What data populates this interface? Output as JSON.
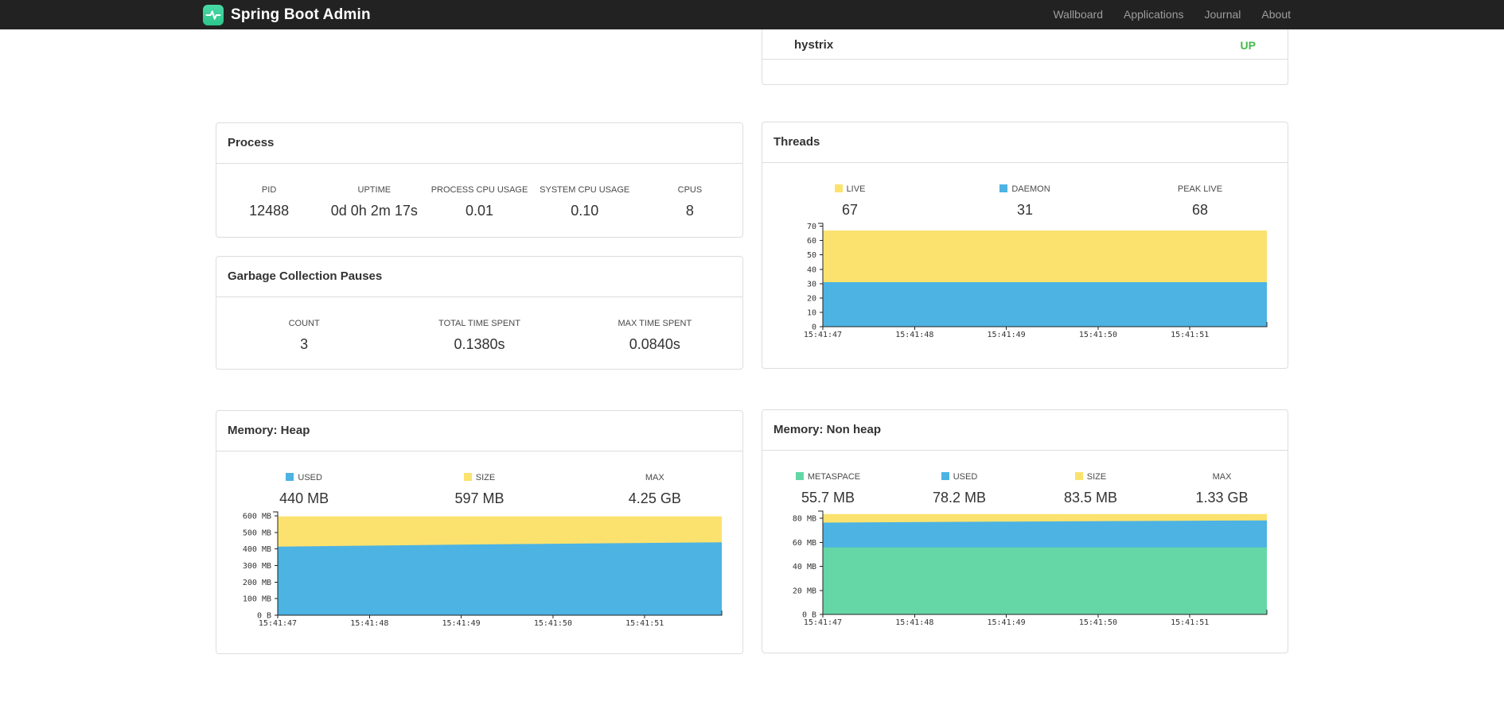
{
  "navbar": {
    "brand": "Spring Boot Admin",
    "links": [
      {
        "label": "Wallboard"
      },
      {
        "label": "Applications"
      },
      {
        "label": "Journal"
      },
      {
        "label": "About"
      }
    ]
  },
  "applications": {
    "rows": [
      {
        "name": "hystrix",
        "status": "UP",
        "status_color": "#45b94a"
      }
    ]
  },
  "process": {
    "title": "Process",
    "metrics": [
      {
        "label": "PID",
        "value": "12488"
      },
      {
        "label": "UPTIME",
        "value": "0d 0h 2m 17s"
      },
      {
        "label": "PROCESS CPU USAGE",
        "value": "0.01"
      },
      {
        "label": "SYSTEM CPU USAGE",
        "value": "0.10"
      },
      {
        "label": "CPUS",
        "value": "8"
      }
    ]
  },
  "gc": {
    "title": "Garbage Collection Pauses",
    "metrics": [
      {
        "label": "COUNT",
        "value": "3"
      },
      {
        "label": "TOTAL TIME SPENT",
        "value": "0.1380s"
      },
      {
        "label": "MAX TIME SPENT",
        "value": "0.0840s"
      }
    ]
  },
  "threads": {
    "title": "Threads",
    "legend": [
      {
        "label": "LIVE",
        "value": "67",
        "swatch": "#fbe26e"
      },
      {
        "label": "DAEMON",
        "value": "31",
        "swatch": "#4db3e3"
      },
      {
        "label": "PEAK LIVE",
        "value": "68",
        "swatch": null
      }
    ]
  },
  "memory_heap": {
    "title": "Memory: Heap",
    "legend": [
      {
        "label": "USED",
        "value": "440 MB",
        "swatch": "#4db3e3"
      },
      {
        "label": "SIZE",
        "value": "597 MB",
        "swatch": "#fbe26e"
      },
      {
        "label": "MAX",
        "value": "4.25 GB",
        "swatch": null
      }
    ]
  },
  "memory_nonheap": {
    "title": "Memory: Non heap",
    "legend": [
      {
        "label": "METASPACE",
        "value": "55.7 MB",
        "swatch": "#65d7a6"
      },
      {
        "label": "USED",
        "value": "78.2 MB",
        "swatch": "#4db3e3"
      },
      {
        "label": "SIZE",
        "value": "83.5 MB",
        "swatch": "#fbe26e"
      },
      {
        "label": "MAX",
        "value": "1.33 GB",
        "swatch": null
      }
    ]
  },
  "chart_data": [
    {
      "id": "threads",
      "type": "area",
      "title": "Threads",
      "x_labels": [
        "15:41:47",
        "15:41:48",
        "15:41:49",
        "15:41:50",
        "15:41:51"
      ],
      "y_max": 72,
      "y_ticks": [
        {
          "v": 0,
          "label": "0"
        },
        {
          "v": 10,
          "label": "10"
        },
        {
          "v": 20,
          "label": "20"
        },
        {
          "v": 30,
          "label": "30"
        },
        {
          "v": 40,
          "label": "40"
        },
        {
          "v": 50,
          "label": "50"
        },
        {
          "v": 60,
          "label": "60"
        },
        {
          "v": 70,
          "label": "70"
        }
      ],
      "series": [
        {
          "name": "LIVE",
          "color": "#fbe26e",
          "values": [
            67,
            67,
            67,
            67,
            67,
            67
          ]
        },
        {
          "name": "DAEMON",
          "color": "#4db3e3",
          "values": [
            31,
            31,
            31,
            31,
            31,
            31
          ]
        }
      ]
    },
    {
      "id": "memory-heap",
      "type": "area",
      "title": "Memory: Heap",
      "x_labels": [
        "15:41:47",
        "15:41:48",
        "15:41:49",
        "15:41:50",
        "15:41:51"
      ],
      "y_max": 624,
      "y_ticks": [
        {
          "v": 0,
          "label": "0 B"
        },
        {
          "v": 100,
          "label": "100 MB"
        },
        {
          "v": 200,
          "label": "200 MB"
        },
        {
          "v": 300,
          "label": "300 MB"
        },
        {
          "v": 400,
          "label": "400 MB"
        },
        {
          "v": 500,
          "label": "500 MB"
        },
        {
          "v": 600,
          "label": "600 MB"
        }
      ],
      "series": [
        {
          "name": "SIZE",
          "color": "#fbe26e",
          "values": [
            597,
            597,
            597,
            597,
            597,
            597
          ]
        },
        {
          "name": "USED",
          "color": "#4db3e3",
          "values": [
            414,
            420,
            426,
            431,
            436,
            440
          ]
        }
      ]
    },
    {
      "id": "memory-nonheap",
      "type": "area",
      "title": "Memory: Non heap",
      "x_labels": [
        "15:41:47",
        "15:41:48",
        "15:41:49",
        "15:41:50",
        "15:41:51"
      ],
      "y_max": 86,
      "y_ticks": [
        {
          "v": 0,
          "label": "0 B"
        },
        {
          "v": 20,
          "label": "20 MB"
        },
        {
          "v": 40,
          "label": "40 MB"
        },
        {
          "v": 60,
          "label": "60 MB"
        },
        {
          "v": 80,
          "label": "80 MB"
        }
      ],
      "series": [
        {
          "name": "SIZE",
          "color": "#fbe26e",
          "values": [
            83.5,
            83.5,
            83.5,
            83.5,
            83.5,
            83.5
          ]
        },
        {
          "name": "USED",
          "color": "#4db3e3",
          "values": [
            76.4,
            76.8,
            77.2,
            77.6,
            77.9,
            78.2
          ]
        },
        {
          "name": "METASPACE",
          "color": "#65d7a6",
          "values": [
            55.7,
            55.7,
            55.7,
            55.7,
            55.7,
            55.7
          ]
        }
      ]
    }
  ]
}
